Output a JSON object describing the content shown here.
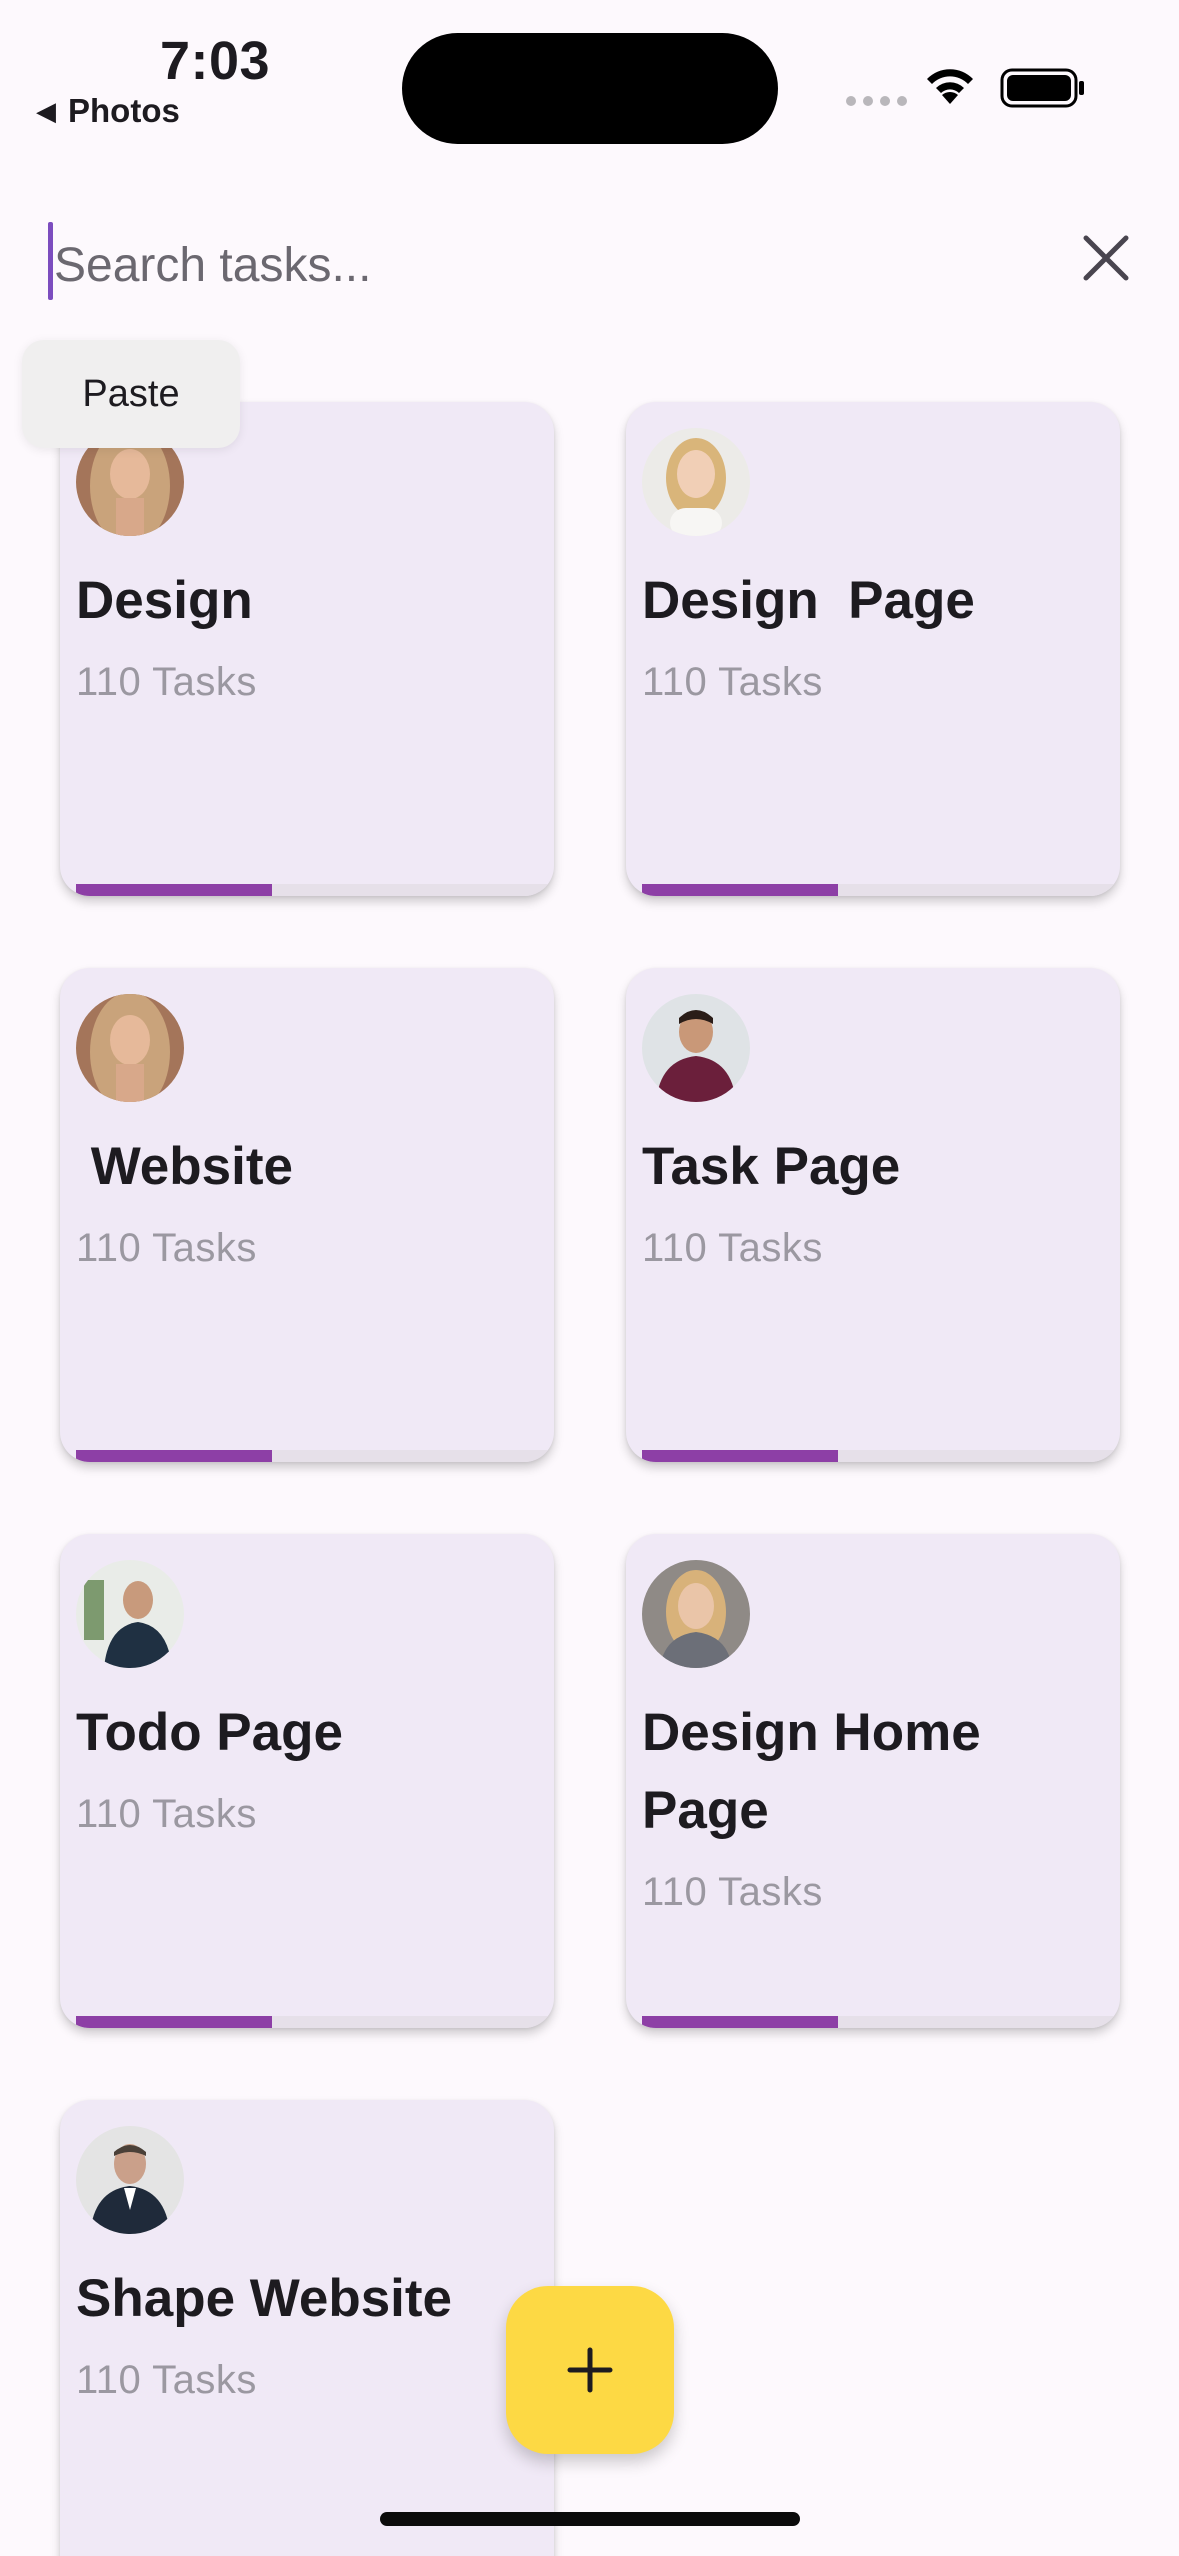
{
  "status_bar": {
    "time": "7:03",
    "back_label": "Photos",
    "back_arrow": "◀"
  },
  "search": {
    "placeholder": "Search tasks...",
    "value": ""
  },
  "context_menu": {
    "paste_label": "Paste"
  },
  "cards": [
    {
      "title": "Design",
      "count": "110 Tasks",
      "progress": 0.41,
      "avatar": "woman-long-hair"
    },
    {
      "title": "Design  Page",
      "count": "110 Tasks",
      "progress": 0.41,
      "avatar": "woman-blonde"
    },
    {
      "title": " Website",
      "count": "110 Tasks",
      "progress": 0.41,
      "avatar": "woman-long-hair"
    },
    {
      "title": "Task Page",
      "count": "110 Tasks",
      "progress": 0.41,
      "avatar": "man-smiling"
    },
    {
      "title": "Todo Page",
      "count": "110 Tasks",
      "progress": 0.41,
      "avatar": "man-office"
    },
    {
      "title": "Design Home Page",
      "count": "110 Tasks",
      "progress": 0.41,
      "avatar": "woman-blonde-2"
    },
    {
      "title": "Shape Website",
      "count": "110 Tasks",
      "progress": 0.41,
      "avatar": "man-suit"
    }
  ],
  "fab": {
    "icon": "plus-icon"
  },
  "colors": {
    "card_bg": "#f0e9f6",
    "progress": "#8d3fa6",
    "fab": "#fdd944",
    "caret": "#7c4dbf"
  }
}
